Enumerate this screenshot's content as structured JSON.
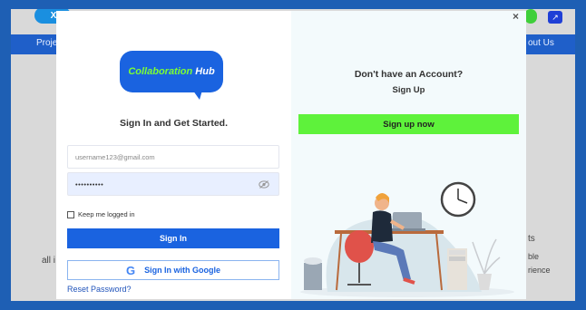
{
  "background_page": {
    "logo_fragment": "Xpe",
    "nav_left_fragment": "Proje",
    "nav_right_fragment": "out Us",
    "text_left_fragment": "all i",
    "text_right_1": "ts",
    "text_right_2": "ble",
    "text_right_3": "rience"
  },
  "modal": {
    "close_label": "×",
    "logo": {
      "part1": "Collaboration",
      "part2": "Hub"
    },
    "signin_title": "Sign In and Get Started.",
    "email": {
      "placeholder": "username123@gmail.com"
    },
    "password": {
      "value": "••••••••••"
    },
    "keep_logged_in": "Keep me logged in",
    "signin_button": "Sign In",
    "google_button": "Sign In with Google",
    "google_icon": "G",
    "reset_link": "Reset Password?",
    "no_account": "Don't have an Account?",
    "signup_link": "Sign Up",
    "signup_button": "Sign up now"
  },
  "colors": {
    "primary": "#1a63e0",
    "accent_green": "#5ef23b",
    "frame": "#1e5fb4"
  }
}
